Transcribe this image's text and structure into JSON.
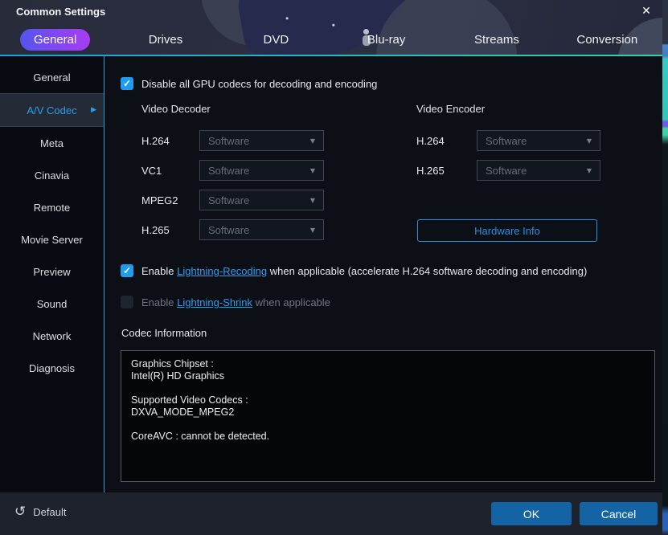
{
  "window": {
    "title": "Common Settings",
    "close_icon": "✕"
  },
  "tabs": {
    "items": [
      {
        "label": "General",
        "active": true
      },
      {
        "label": "Drives"
      },
      {
        "label": "DVD"
      },
      {
        "label": "Blu-ray"
      },
      {
        "label": "Streams"
      },
      {
        "label": "Conversion"
      }
    ]
  },
  "sidebar": {
    "items": [
      {
        "label": "General"
      },
      {
        "label": "A/V Codec",
        "selected": true
      },
      {
        "label": "Meta"
      },
      {
        "label": "Cinavia"
      },
      {
        "label": "Remote"
      },
      {
        "label": "Movie Server"
      },
      {
        "label": "Preview"
      },
      {
        "label": "Sound"
      },
      {
        "label": "Network"
      },
      {
        "label": "Diagnosis"
      }
    ]
  },
  "main": {
    "gpu": {
      "label": "Disable all GPU codecs for decoding and encoding",
      "checked": true
    },
    "decoder": {
      "title": "Video Decoder",
      "rows": [
        {
          "label": "H.264",
          "value": "Software"
        },
        {
          "label": "VC1",
          "value": "Software"
        },
        {
          "label": "MPEG2",
          "value": "Software"
        },
        {
          "label": "H.265",
          "value": "Software"
        }
      ]
    },
    "encoder": {
      "title": "Video Encoder",
      "rows": [
        {
          "label": "H.264",
          "value": "Software"
        },
        {
          "label": "H.265",
          "value": "Software"
        }
      ]
    },
    "hardware_info_label": "Hardware Info",
    "recoding": {
      "prefix": "Enable ",
      "link": "Lightning-Recoding",
      "suffix": " when applicable (accelerate H.264 software decoding and encoding)",
      "checked": true
    },
    "shrink": {
      "prefix": "Enable ",
      "link": "Lightning-Shrink",
      "suffix": " when applicable",
      "checked": false
    },
    "codec_info_title": "Codec Information",
    "codec_info_text": "Graphics Chipset :\nIntel(R) HD Graphics\n\nSupported Video Codecs :\nDXVA_MODE_MPEG2\n\nCoreAVC : cannot be detected."
  },
  "footer": {
    "default_label": "Default",
    "ok_label": "OK",
    "cancel_label": "Cancel"
  },
  "colors": {
    "accent_blue": "#1e9cf0",
    "link_blue": "#2b9ff0",
    "pill_gradient_start": "#5455ee",
    "pill_gradient_end": "#a93bf2",
    "underline_start": "#1a9fd9",
    "underline_end": "#30d3a5",
    "button_blue": "#1464a5"
  }
}
